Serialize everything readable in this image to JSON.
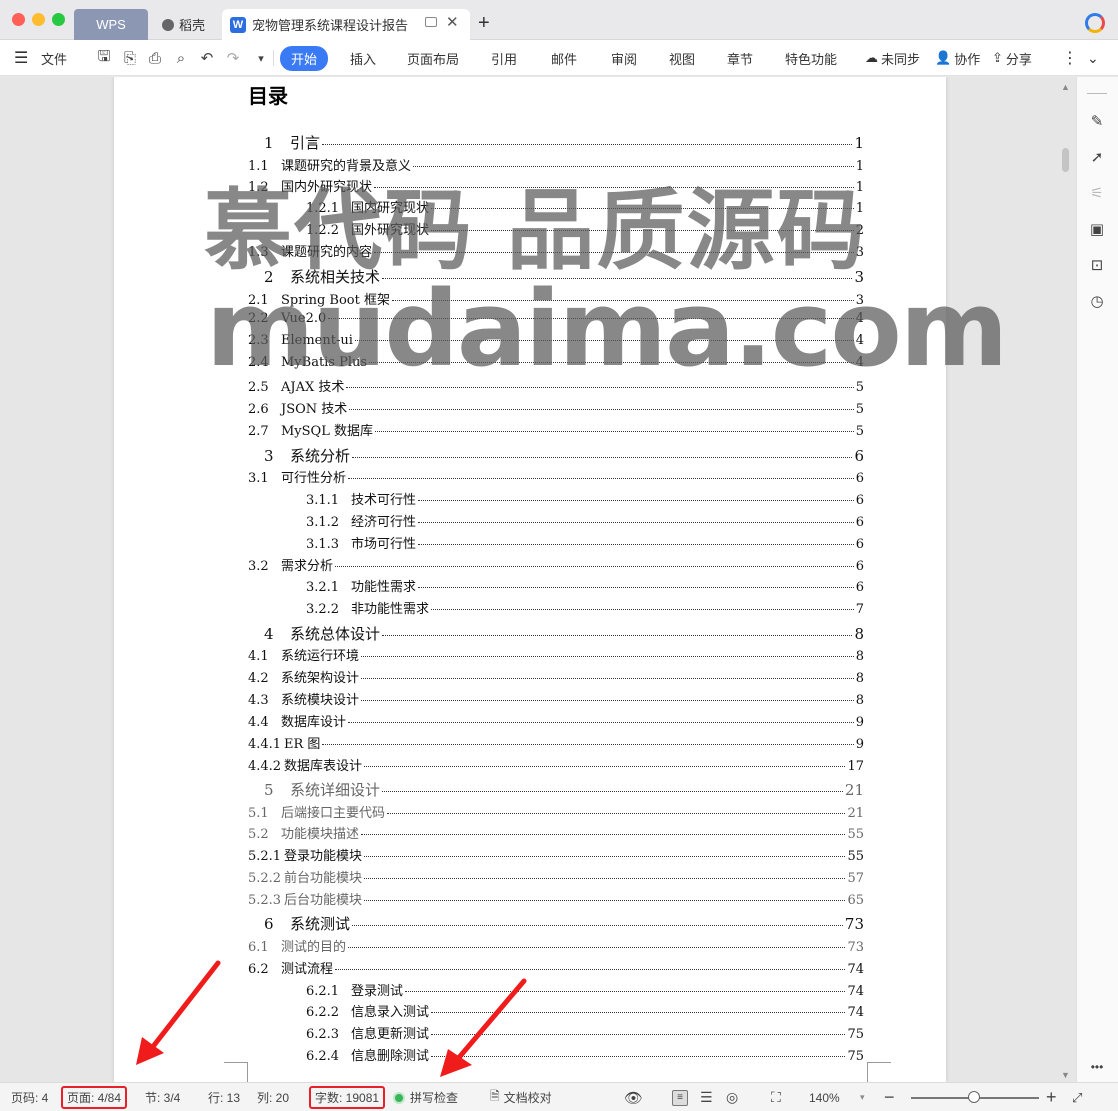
{
  "window": {
    "tabs": [
      {
        "label": "WPS"
      },
      {
        "label": "稻壳"
      },
      {
        "label": "宠物管理系统课程设计报告"
      }
    ]
  },
  "menu": {
    "file": "文件",
    "items": [
      "开始",
      "插入",
      "页面布局",
      "引用",
      "邮件",
      "审阅",
      "视图",
      "章节",
      "特色功能"
    ],
    "sync": "未同步",
    "collab": "协作",
    "share": "分享"
  },
  "document": {
    "toc_title": "目录",
    "entries": [
      {
        "num": "1",
        "label": "引言",
        "page": "1",
        "level": 0
      },
      {
        "num": "1.1",
        "label": "课题研究的背景及意义",
        "page": "1",
        "level": 1
      },
      {
        "num": "1.2",
        "label": "国内外研究现状",
        "page": "1",
        "level": 1
      },
      {
        "num": "1.2.1",
        "label": "国内研究现状",
        "page": "1",
        "level": 2
      },
      {
        "num": "1.2.2",
        "label": "国外研究现状",
        "page": "2",
        "level": 2
      },
      {
        "num": "1.3",
        "label": "课题研究的内容",
        "page": "3",
        "level": 1
      },
      {
        "num": "2",
        "label": "系统相关技术",
        "page": "3",
        "level": 0
      },
      {
        "num": "2.1",
        "label": "Spring Boot 框架",
        "page": "3",
        "level": 1
      },
      {
        "num": "2.2",
        "label": "Vue2.0",
        "page": "4",
        "level": 1
      },
      {
        "num": "2.3",
        "label": "Element-ui",
        "page": "4",
        "level": 1
      },
      {
        "num": "2.4",
        "label": "MyBatis Plus",
        "page": "4",
        "level": 1
      },
      {
        "num": "2.5",
        "label": "AJAX 技术",
        "page": "5",
        "level": 1
      },
      {
        "num": "2.6",
        "label": "JSON 技术",
        "page": "5",
        "level": 1
      },
      {
        "num": "2.7",
        "label": "MySQL 数据库",
        "page": "5",
        "level": 1
      },
      {
        "num": "3",
        "label": "系统分析",
        "page": "6",
        "level": 0
      },
      {
        "num": "3.1",
        "label": "可行性分析",
        "page": "6",
        "level": 1
      },
      {
        "num": "3.1.1",
        "label": "技术可行性",
        "page": "6",
        "level": 2
      },
      {
        "num": "3.1.2",
        "label": "经济可行性",
        "page": "6",
        "level": 2
      },
      {
        "num": "3.1.3",
        "label": "市场可行性",
        "page": "6",
        "level": 2
      },
      {
        "num": "3.2",
        "label": "需求分析",
        "page": "6",
        "level": 1
      },
      {
        "num": "3.2.1",
        "label": "功能性需求",
        "page": "6",
        "level": 2
      },
      {
        "num": "3.2.2",
        "label": "非功能性需求",
        "page": "7",
        "level": 2
      },
      {
        "num": "4",
        "label": "系统总体设计",
        "page": "8",
        "level": 0
      },
      {
        "num": "4.1",
        "label": "系统运行环境",
        "page": "8",
        "level": 1
      },
      {
        "num": "4.2",
        "label": "系统架构设计",
        "page": "8",
        "level": 1
      },
      {
        "num": "4.3",
        "label": "系统模块设计",
        "page": "8",
        "level": 1
      },
      {
        "num": "4.4",
        "label": "数据库设计",
        "page": "9",
        "level": 1
      },
      {
        "num": "4.4.1",
        "label": "ER 图",
        "page": "9",
        "level": 1
      },
      {
        "num": "4.4.2",
        "label": "数据库表设计",
        "page": "17",
        "level": 1
      },
      {
        "num": "5",
        "label": "系统详细设计",
        "page": "21",
        "level": 0,
        "grey": true
      },
      {
        "num": "5.1",
        "label": "后端接口主要代码",
        "page": "21",
        "level": 1,
        "grey": true
      },
      {
        "num": "5.2",
        "label": "功能模块描述",
        "page": "55",
        "level": 1,
        "grey": true
      },
      {
        "num": "5.2.1",
        "label": "登录功能模块",
        "page": "55",
        "level": 1
      },
      {
        "num": "5.2.2",
        "label": "前台功能模块",
        "page": "57",
        "level": 1,
        "grey": true
      },
      {
        "num": "5.2.3",
        "label": "后台功能模块",
        "page": "65",
        "level": 1,
        "grey": true
      },
      {
        "num": "6",
        "label": "系统测试",
        "page": "73",
        "level": 0
      },
      {
        "num": "6.1",
        "label": "测试的目的",
        "page": "73",
        "level": 1,
        "grey": true
      },
      {
        "num": "6.2",
        "label": "测试流程",
        "page": "74",
        "level": 1
      },
      {
        "num": "6.2.1",
        "label": "登录测试",
        "page": "74",
        "level": 2
      },
      {
        "num": "6.2.2",
        "label": "信息录入测试",
        "page": "74",
        "level": 2
      },
      {
        "num": "6.2.3",
        "label": "信息更新测试",
        "page": "75",
        "level": 2
      },
      {
        "num": "6.2.4",
        "label": "信息删除测试",
        "page": "75",
        "level": 2
      }
    ],
    "watermark_line1": "慕代码 品质源码",
    "watermark_line2": "mudaima.com"
  },
  "status": {
    "page_code": "页码: 4",
    "page": "页面: 4/84",
    "section": "节: 3/4",
    "row": "行: 13",
    "col": "列: 20",
    "word_count": "字数: 19081",
    "spell_check": "拼写检查",
    "proofread": "文档校对",
    "zoom": "140%"
  },
  "colors": {
    "accent": "#3a7bf5",
    "highlight_red": "#e8202a"
  }
}
